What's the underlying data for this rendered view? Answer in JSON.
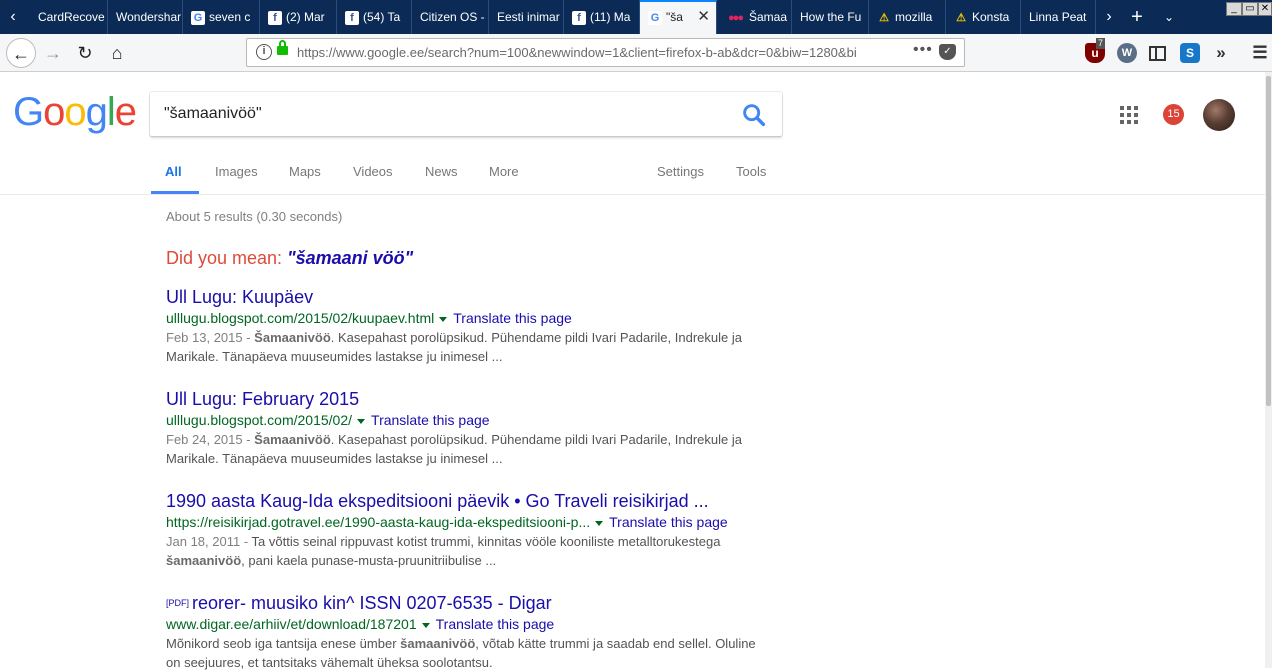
{
  "browser": {
    "tabs": [
      {
        "label": "CardRecove",
        "icon": "none"
      },
      {
        "label": "Wondershar",
        "icon": "none"
      },
      {
        "label": "seven c",
        "icon": "google"
      },
      {
        "label": "(2) Mar",
        "icon": "facebook"
      },
      {
        "label": "(54) Ta",
        "icon": "facebook"
      },
      {
        "label": "Citizen OS -",
        "icon": "none"
      },
      {
        "label": "Eesti inimar",
        "icon": "none"
      },
      {
        "label": "(11) Ma",
        "icon": "facebook"
      },
      {
        "label": "\"ša",
        "icon": "google",
        "active": true
      },
      {
        "label": "Šamaa",
        "icon": "dots"
      },
      {
        "label": "How the Fu",
        "icon": "none"
      },
      {
        "label": "mozilla",
        "icon": "warning"
      },
      {
        "label": "Konsta",
        "icon": "warning"
      },
      {
        "label": "Linna Peat",
        "icon": "none"
      }
    ],
    "new_tab_symbol": "+",
    "url": "https://www.google.ee/search?num=100&newwindow=1&client=firefox-b-ab&dcr=0&biw=1280&bi",
    "ublock_count": "7",
    "window_buttons": [
      "_",
      "▭",
      "✕"
    ]
  },
  "google": {
    "logo_letters": [
      {
        "ch": "G",
        "color": "#4285f4"
      },
      {
        "ch": "o",
        "color": "#ea4335"
      },
      {
        "ch": "o",
        "color": "#fbbc05"
      },
      {
        "ch": "g",
        "color": "#4285f4"
      },
      {
        "ch": "l",
        "color": "#34a853"
      },
      {
        "ch": "e",
        "color": "#ea4335"
      }
    ],
    "search_query": "\"šamaanivöö\"",
    "notification_count": "15",
    "tabs": {
      "all": "All",
      "images": "Images",
      "maps": "Maps",
      "videos": "Videos",
      "news": "News",
      "more": "More",
      "settings": "Settings",
      "tools": "Tools"
    },
    "stats": "About 5 results (0.30 seconds)",
    "did_you_mean_label": "Did you mean:",
    "did_you_mean_suggestion": "\"šamaani vöö\"",
    "results": [
      {
        "title": "Ull Lugu: Kuupäev",
        "url": "ulllugu.blogspot.com/2015/02/kuupaev.html",
        "translate": "Translate this page",
        "date": "Feb 13, 2015 - ",
        "bold": "Šamaanivöö",
        "snippet": ". Kasepahast porolüpsikud. Pühendame pildi Ivari Padarile, Indrekule ja Marikale. Tänapäeva muuseumides lastakse ju inimesel ..."
      },
      {
        "title": "Ull Lugu: February 2015",
        "url": "ulllugu.blogspot.com/2015/02/",
        "translate": "Translate this page",
        "date": "Feb 24, 2015 - ",
        "bold": "Šamaanivöö",
        "snippet": ". Kasepahast porolüpsikud. Pühendame pildi Ivari Padarile, Indrekule ja Marikale. Tänapäeva muuseumides lastakse ju inimesel ..."
      },
      {
        "title": "1990 aasta Kaug-Ida ekspeditsiooni päevik • Go Traveli reisikirjad ...",
        "url": "https://reisikirjad.gotravel.ee/1990-aasta-kaug-ida-ekspeditsiooni-p...",
        "translate": "Translate this page",
        "date": "Jan 18, 2011 - ",
        "snippet_before": "Ta võttis seinal rippuvast kotist trummi, kinnitas vööle kooniliste metalltorukestega ",
        "bold": "šamaanivöö",
        "snippet": ", pani kaela punase-musta-pruunitriibulise ..."
      },
      {
        "pdf_tag": "[PDF]",
        "title": "reorer- muusiko kin^ ISSN 0207-6535 - Digar",
        "url": "www.digar.ee/arhiiv/et/download/187201",
        "translate": "Translate this page",
        "snippet_before": "Mõnikord seob iga tantsija enese ümber ",
        "bold": "šamaanivöö",
        "snippet": ", võtab kätte trummi ja saadab end sellel. Oluline on seejuures, et tantsitaks vähemalt üheksa soolotantsu."
      }
    ]
  }
}
